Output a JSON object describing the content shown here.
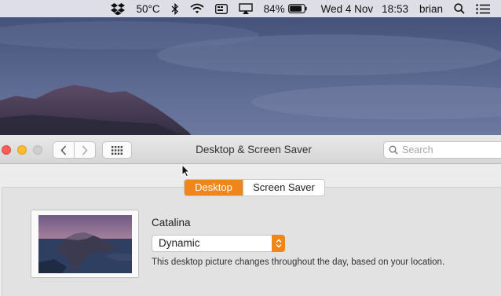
{
  "menubar": {
    "temperature": "50°C",
    "battery_percent": "84%",
    "date": "Wed 4 Nov",
    "time": "18:53",
    "user": "brian",
    "icons": [
      "dropbox-icon",
      "bluetooth-icon",
      "wifi-icon",
      "input-source-icon",
      "airplay-icon",
      "battery-icon",
      "spotlight-icon",
      "control-list-icon"
    ],
    "battery_level": 0.84
  },
  "window": {
    "title": "Desktop & Screen Saver",
    "search_placeholder": "Search"
  },
  "tabs": [
    {
      "label": "Desktop",
      "selected": true
    },
    {
      "label": "Screen Saver",
      "selected": false
    }
  ],
  "picture": {
    "name": "Catalina",
    "mode_selected": "Dynamic",
    "description": "This desktop picture changes throughout the day, based on your location."
  },
  "colors": {
    "accent": "#f0851a",
    "close": "#fc5f57",
    "minimize": "#fdbc2e"
  }
}
